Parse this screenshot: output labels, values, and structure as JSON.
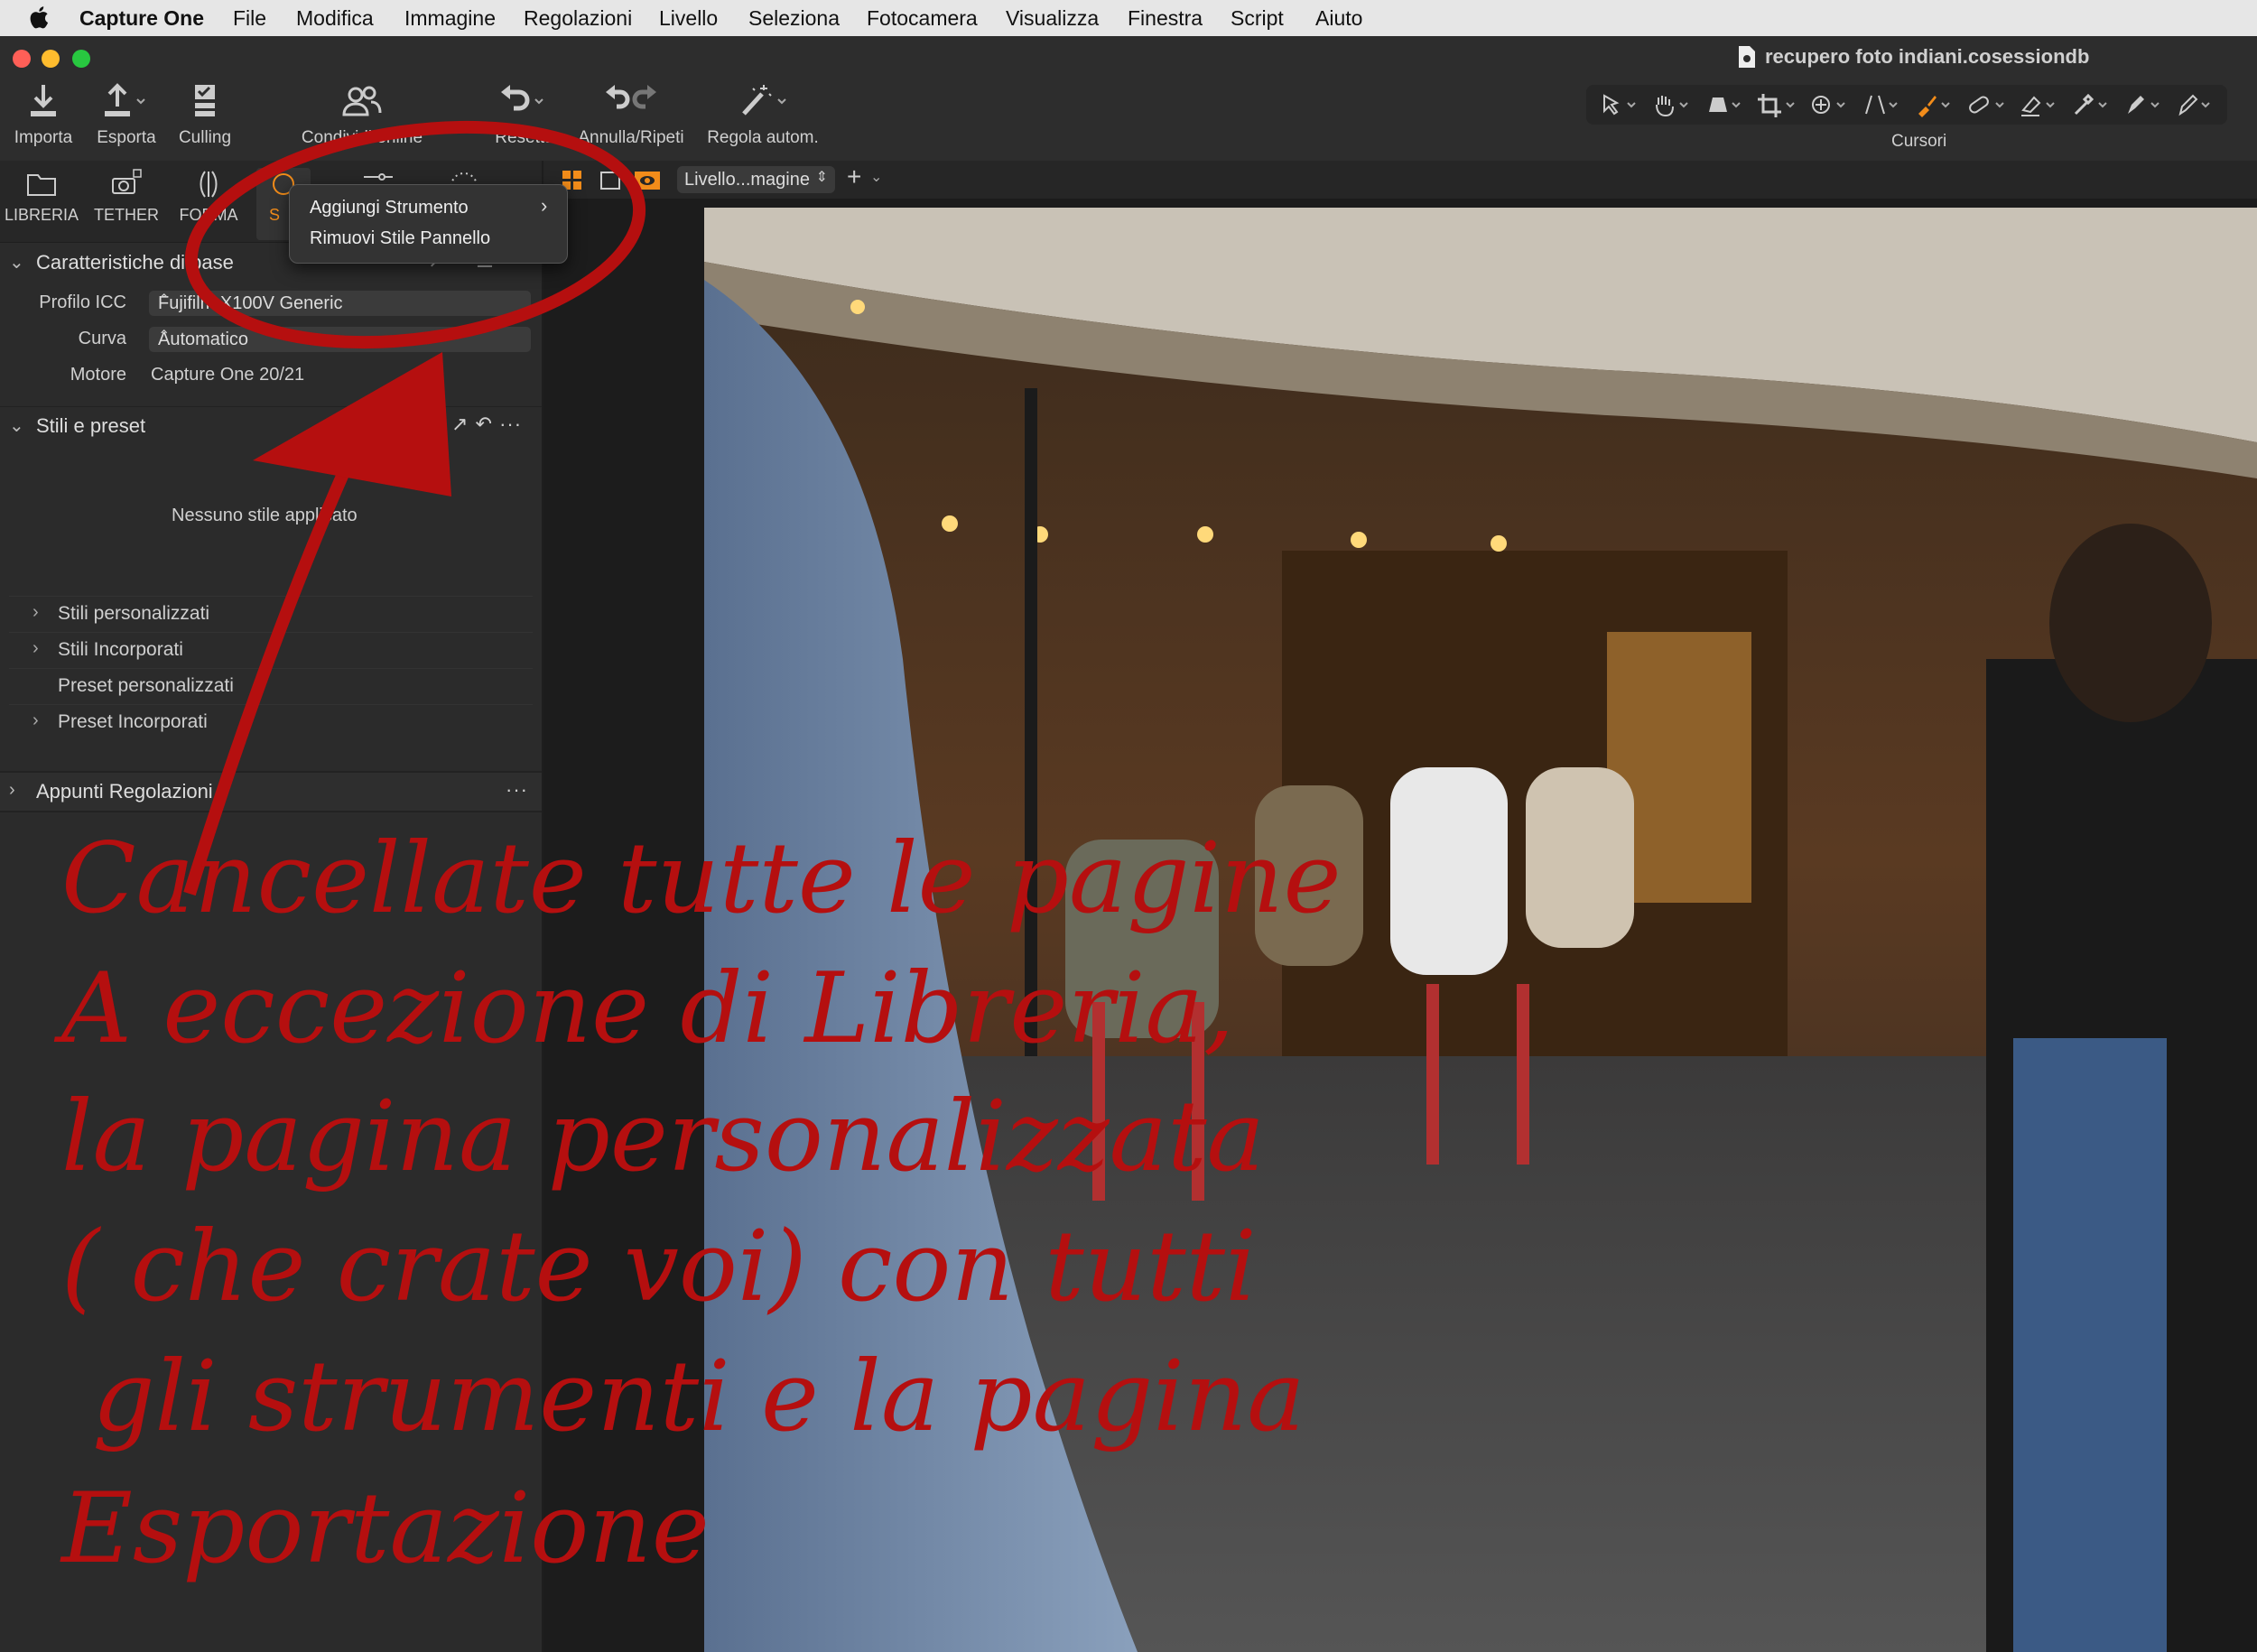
{
  "menubar": {
    "app_name": "Capture One",
    "items": [
      "File",
      "Modifica",
      "Immagine",
      "Regolazioni",
      "Livello",
      "Seleziona",
      "Fotocamera",
      "Visualizza",
      "Finestra",
      "Script",
      "Aiuto"
    ]
  },
  "window": {
    "document_title": "recupero foto indiani.cosessiondb"
  },
  "toolbar": {
    "import": "Importa",
    "export": "Esporta",
    "culling": "Culling",
    "share": "Condividi online",
    "reset": "Resetta",
    "undo_redo": "Annulla/Ripeti",
    "auto_adjust": "Regola autom.",
    "cursors": "Cursori"
  },
  "tool_tabs": {
    "library": "LIBRERIA",
    "tether": "TETHER",
    "shape": "FORMA",
    "style_partial": "S"
  },
  "context_menu": {
    "add_tool": "Aggiungi Strumento",
    "remove_panel_style": "Rimuovi Stile Pannello"
  },
  "basic_characteristics": {
    "title": "Caratteristiche di base",
    "icc_label": "Profilo ICC",
    "icc_value": "Fujifilm X100V Generic",
    "curve_label": "Curva",
    "curve_value": "Automatico",
    "engine_label": "Motore",
    "engine_value": "Capture One 20/21"
  },
  "styles_presets": {
    "title": "Stili e preset",
    "empty": "Nessuno stile applicato",
    "rows": [
      "Stili personalizzati",
      "Stili Incorporati",
      "Preset personalizzati",
      "Preset Incorporati"
    ]
  },
  "adjust_clipboard": {
    "title": "Appunti Regolazioni"
  },
  "viewer": {
    "layer_select": "Livello...magine"
  },
  "annotation": {
    "lines": [
      "Cancellate tutte le pagine",
      "A eccezione di Libreria,",
      "la pagina personalizzata",
      "( che crate voi) con tutti",
      " gli strumenti e la pagina",
      "Esportazione"
    ]
  },
  "colors": {
    "annotation_red": "#b50f0f",
    "accent_orange": "#f28c1a",
    "panel_bg": "#2b2b2b"
  }
}
